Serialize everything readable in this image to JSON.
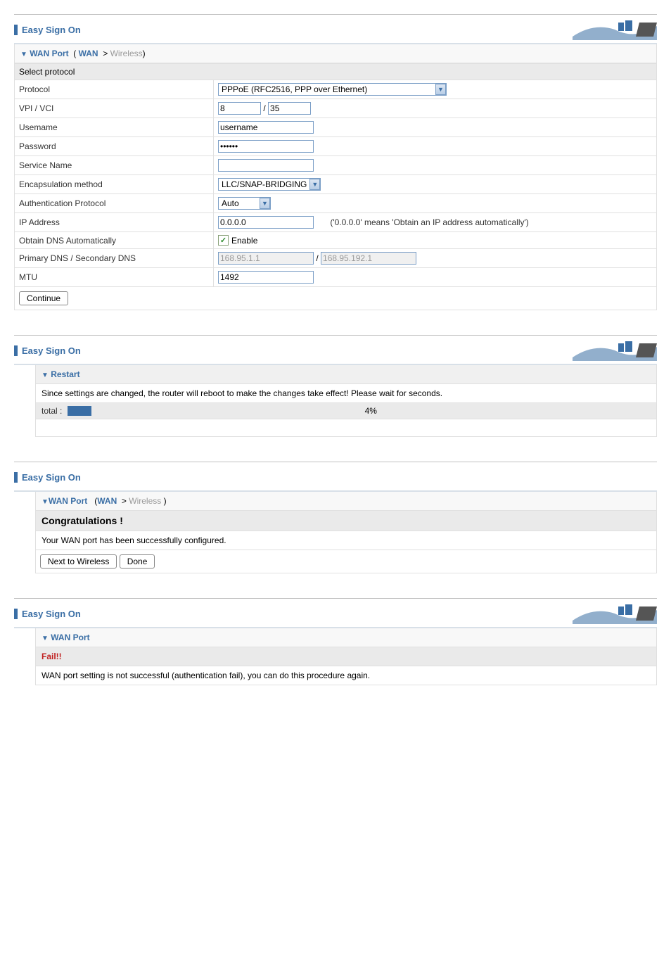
{
  "panel1": {
    "title": "Easy Sign On",
    "breadcrumb": {
      "wan_port": "WAN Port",
      "wan": "WAN",
      "wireless": "Wireless"
    },
    "group_header": "Select protocol",
    "rows": {
      "protocol": {
        "label": "Protocol",
        "value": "PPPoE (RFC2516, PPP over Ethernet)"
      },
      "vpi_vci": {
        "label": "VPI / VCI",
        "vpi": "8",
        "vci": "35",
        "sep": "/"
      },
      "username": {
        "label": "Usemame",
        "value": "username"
      },
      "password": {
        "label": "Password",
        "value": "••••••"
      },
      "service_name": {
        "label": "Service Name",
        "value": ""
      },
      "encapsulation": {
        "label": "Encapsulation method",
        "value": "LLC/SNAP-BRIDGING"
      },
      "auth_protocol": {
        "label": "Authentication Protocol",
        "value": "Auto"
      },
      "ip_address": {
        "label": "IP Address",
        "value": "0.0.0.0",
        "hint": "('0.0.0.0' means 'Obtain an IP address automatically')"
      },
      "obtain_dns": {
        "label": "Obtain DNS Automatically",
        "checkbox_label": "Enable"
      },
      "dns": {
        "label": "Primary DNS / Secondary DNS",
        "primary": "168.95.1.1",
        "secondary": "168.95.192.1",
        "sep": "/"
      },
      "mtu": {
        "label": "MTU",
        "value": "1492"
      }
    },
    "continue_btn": "Continue"
  },
  "panel2": {
    "title": "Easy Sign On",
    "restart_header": "Restart",
    "message": "Since settings are changed, the router will reboot to make the changes take effect! Please wait for seconds.",
    "progress_label": "total :",
    "progress_percent": "4%"
  },
  "panel3": {
    "title": "Easy Sign On",
    "breadcrumb": {
      "wan_port": "WAN Port",
      "wan": "WAN",
      "wireless": "Wireless"
    },
    "congrats": "Congratulations !",
    "message": "Your WAN port has been successfully configured.",
    "next_btn": "Next to Wireless",
    "done_btn": "Done"
  },
  "panel4": {
    "title": "Easy Sign On",
    "wan_port": "WAN Port",
    "fail": "Fail!!",
    "message": "WAN port setting is not successful (authentication fail), you can do this procedure again."
  }
}
